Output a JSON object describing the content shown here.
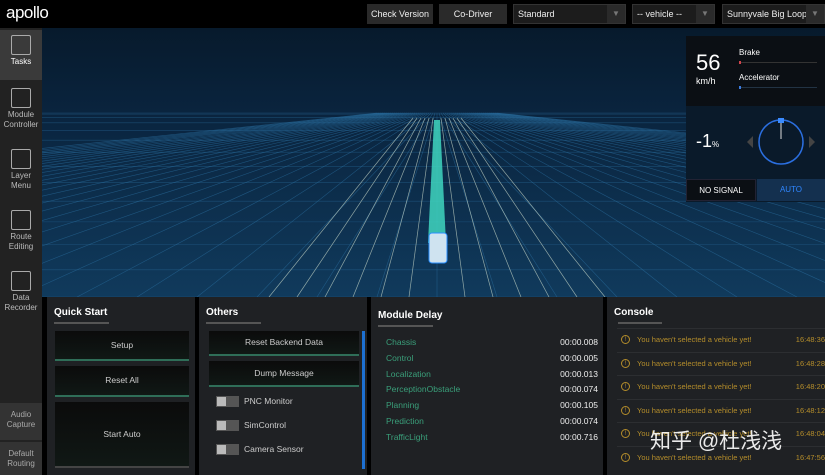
{
  "header": {
    "logo": "apollo",
    "check_version": "Check Version",
    "co_driver": "Co-Driver",
    "mode": "Standard",
    "vehicle": "-- vehicle --",
    "map": "Sunnyvale Big Loop"
  },
  "sidebar": {
    "items": [
      {
        "label": "Tasks"
      },
      {
        "label": "Module Controller"
      },
      {
        "label": "Layer Menu"
      },
      {
        "label": "Route Editing"
      },
      {
        "label": "Data Recorder"
      }
    ],
    "bottom": [
      {
        "label": "Audio Capture"
      },
      {
        "label": "Default Routing"
      }
    ]
  },
  "hud": {
    "speed": "56",
    "speed_unit": "km/h",
    "brake_label": "Brake",
    "accel_label": "Accelerator",
    "brake_pct": 3,
    "accel_pct": 3,
    "steering": "-1",
    "steering_unit": "%",
    "signal": "NO SIGNAL",
    "drive_mode": "AUTO"
  },
  "quick_start": {
    "title": "Quick Start",
    "buttons": [
      "Setup",
      "Reset All",
      "Start Auto"
    ]
  },
  "others": {
    "title": "Others",
    "buttons": [
      "Reset Backend Data",
      "Dump Message"
    ],
    "toggles": [
      "PNC Monitor",
      "SimControl",
      "Camera Sensor"
    ]
  },
  "module_delay": {
    "title": "Module Delay",
    "rows": [
      {
        "name": "Chassis",
        "value": "00:00.008"
      },
      {
        "name": "Control",
        "value": "00:00.005"
      },
      {
        "name": "Localization",
        "value": "00:00.013"
      },
      {
        "name": "PerceptionObstacle",
        "value": "00:00.074"
      },
      {
        "name": "Planning",
        "value": "00:00.105"
      },
      {
        "name": "Prediction",
        "value": "00:00.074"
      },
      {
        "name": "TrafficLight",
        "value": "00:00.716"
      }
    ]
  },
  "console": {
    "title": "Console",
    "rows": [
      {
        "msg": "You haven't selected a vehicle yet!",
        "time": "16:48:36"
      },
      {
        "msg": "You haven't selected a vehicle yet!",
        "time": "16:48:28"
      },
      {
        "msg": "You haven't selected a vehicle yet!",
        "time": "16:48:20"
      },
      {
        "msg": "You haven't selected a vehicle yet!",
        "time": "16:48:12"
      },
      {
        "msg": "You haven't selected a vehicle yet!",
        "time": "16:48:04"
      },
      {
        "msg": "You haven't selected a vehicle yet!",
        "time": "16:47:56"
      }
    ]
  },
  "watermark": "知乎 @杜浅浅"
}
